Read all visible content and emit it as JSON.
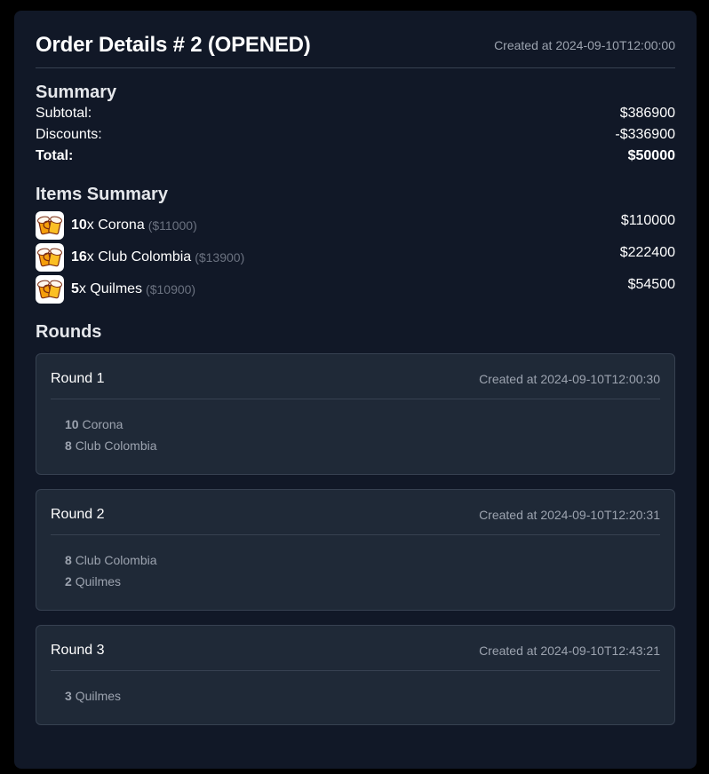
{
  "header": {
    "title": "Order Details # 2 (OPENED)",
    "created": "Created at 2024-09-10T12:00:00"
  },
  "summary": {
    "title": "Summary",
    "subtotal_label": "Subtotal:",
    "subtotal_value": "$386900",
    "discounts_label": "Discounts:",
    "discounts_value": "-$336900",
    "total_label": "Total:",
    "total_value": "$50000"
  },
  "items_summary": {
    "title": "Items Summary",
    "items": [
      {
        "qty": "10",
        "x": "x",
        "name": "Corona",
        "unit_price": "($11000)",
        "total": "$110000",
        "icon": "beer-mugs-icon"
      },
      {
        "qty": "16",
        "x": "x",
        "name": "Club Colombia",
        "unit_price": "($13900)",
        "total": "$222400",
        "icon": "beer-mugs-icon"
      },
      {
        "qty": "5",
        "x": "x",
        "name": "Quilmes",
        "unit_price": "($10900)",
        "total": "$54500",
        "icon": "beer-mugs-icon"
      }
    ]
  },
  "rounds": {
    "title": "Rounds",
    "list": [
      {
        "title": "Round 1",
        "created": "Created at 2024-09-10T12:00:30",
        "lines": [
          {
            "qty": "10",
            "name": "Corona"
          },
          {
            "qty": "8",
            "name": "Club Colombia"
          }
        ]
      },
      {
        "title": "Round 2",
        "created": "Created at 2024-09-10T12:20:31",
        "lines": [
          {
            "qty": "8",
            "name": "Club Colombia"
          },
          {
            "qty": "2",
            "name": "Quilmes"
          }
        ]
      },
      {
        "title": "Round 3",
        "created": "Created at 2024-09-10T12:43:21",
        "lines": [
          {
            "qty": "3",
            "name": "Quilmes"
          }
        ]
      }
    ]
  },
  "colors": {
    "background": "#000000",
    "card": "#111827",
    "round_card": "#1f2937",
    "border": "#374151",
    "muted_text": "#9ca3af",
    "beer_amber": "#f59e0b"
  }
}
